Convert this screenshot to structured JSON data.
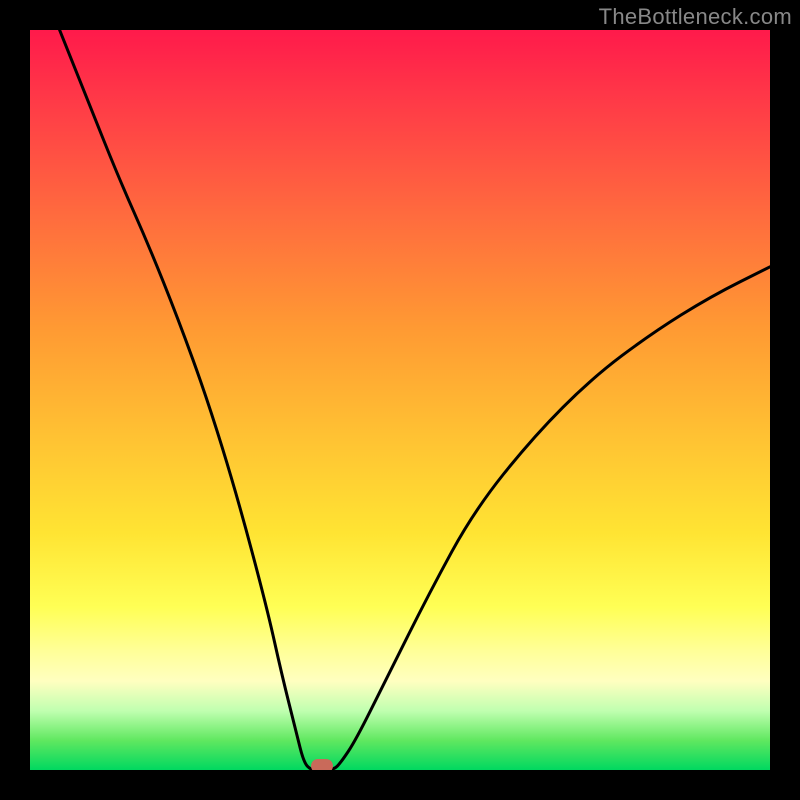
{
  "watermark": "TheBottleneck.com",
  "chart_data": {
    "type": "line",
    "title": "",
    "xlabel": "",
    "ylabel": "",
    "xlim": [
      0,
      100
    ],
    "ylim": [
      0,
      100
    ],
    "grid": false,
    "legend": false,
    "series": [
      {
        "name": "bottleneck-curve",
        "x": [
          4,
          8,
          12,
          16,
          20,
          24,
          28,
          32,
          34,
          36,
          37,
          38,
          39,
          41,
          42,
          44,
          48,
          54,
          60,
          68,
          76,
          84,
          92,
          100
        ],
        "y": [
          100,
          90,
          80,
          71,
          61,
          50,
          37,
          22,
          13,
          5,
          1,
          0,
          0,
          0,
          1,
          4,
          12,
          24,
          35,
          45,
          53,
          59,
          64,
          68
        ]
      }
    ],
    "marker": {
      "x": 39.5,
      "y": 0.5,
      "color": "#c96a5a"
    },
    "background_gradient": {
      "stops": [
        {
          "pos": 0,
          "color": "#ff1a4b"
        },
        {
          "pos": 10,
          "color": "#ff3b47"
        },
        {
          "pos": 25,
          "color": "#ff6b3e"
        },
        {
          "pos": 40,
          "color": "#ff9933"
        },
        {
          "pos": 55,
          "color": "#ffc233"
        },
        {
          "pos": 68,
          "color": "#ffe433"
        },
        {
          "pos": 78,
          "color": "#ffff55"
        },
        {
          "pos": 84,
          "color": "#ffff99"
        },
        {
          "pos": 88,
          "color": "#ffffc0"
        },
        {
          "pos": 92,
          "color": "#c0ffb0"
        },
        {
          "pos": 96,
          "color": "#60e860"
        },
        {
          "pos": 100,
          "color": "#00d860"
        }
      ]
    }
  }
}
